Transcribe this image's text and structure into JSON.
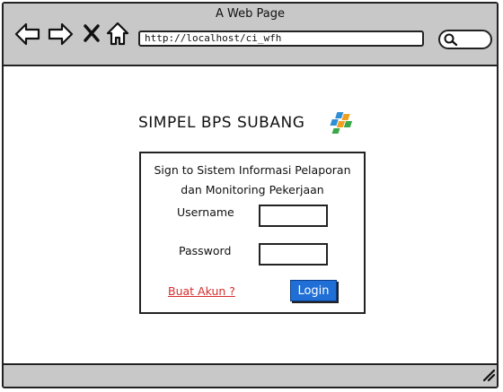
{
  "window": {
    "title": "A Web Page",
    "address": "http://localhost/ci_wfh",
    "nav_icons": [
      "back-arrow-icon",
      "forward-arrow-icon",
      "close-x-icon",
      "home-icon"
    ],
    "search_icon": "search-icon"
  },
  "page": {
    "app_title": "SIMPEL BPS SUBANG",
    "logo_icon": "bps-logo-icon"
  },
  "login_form": {
    "heading_line1": "Sign to Sistem Informasi Pelaporan",
    "heading_line2": "dan Monitoring Pekerjaan",
    "username_label": "Username",
    "username_value": "",
    "password_label": "Password",
    "password_value": "",
    "create_account_link": "Buat Akun ?",
    "login_button": "Login"
  },
  "colors": {
    "chrome_bg": "#c8c8c8",
    "login_button_bg": "#1f6fd6",
    "link_color": "#d62d2d"
  }
}
